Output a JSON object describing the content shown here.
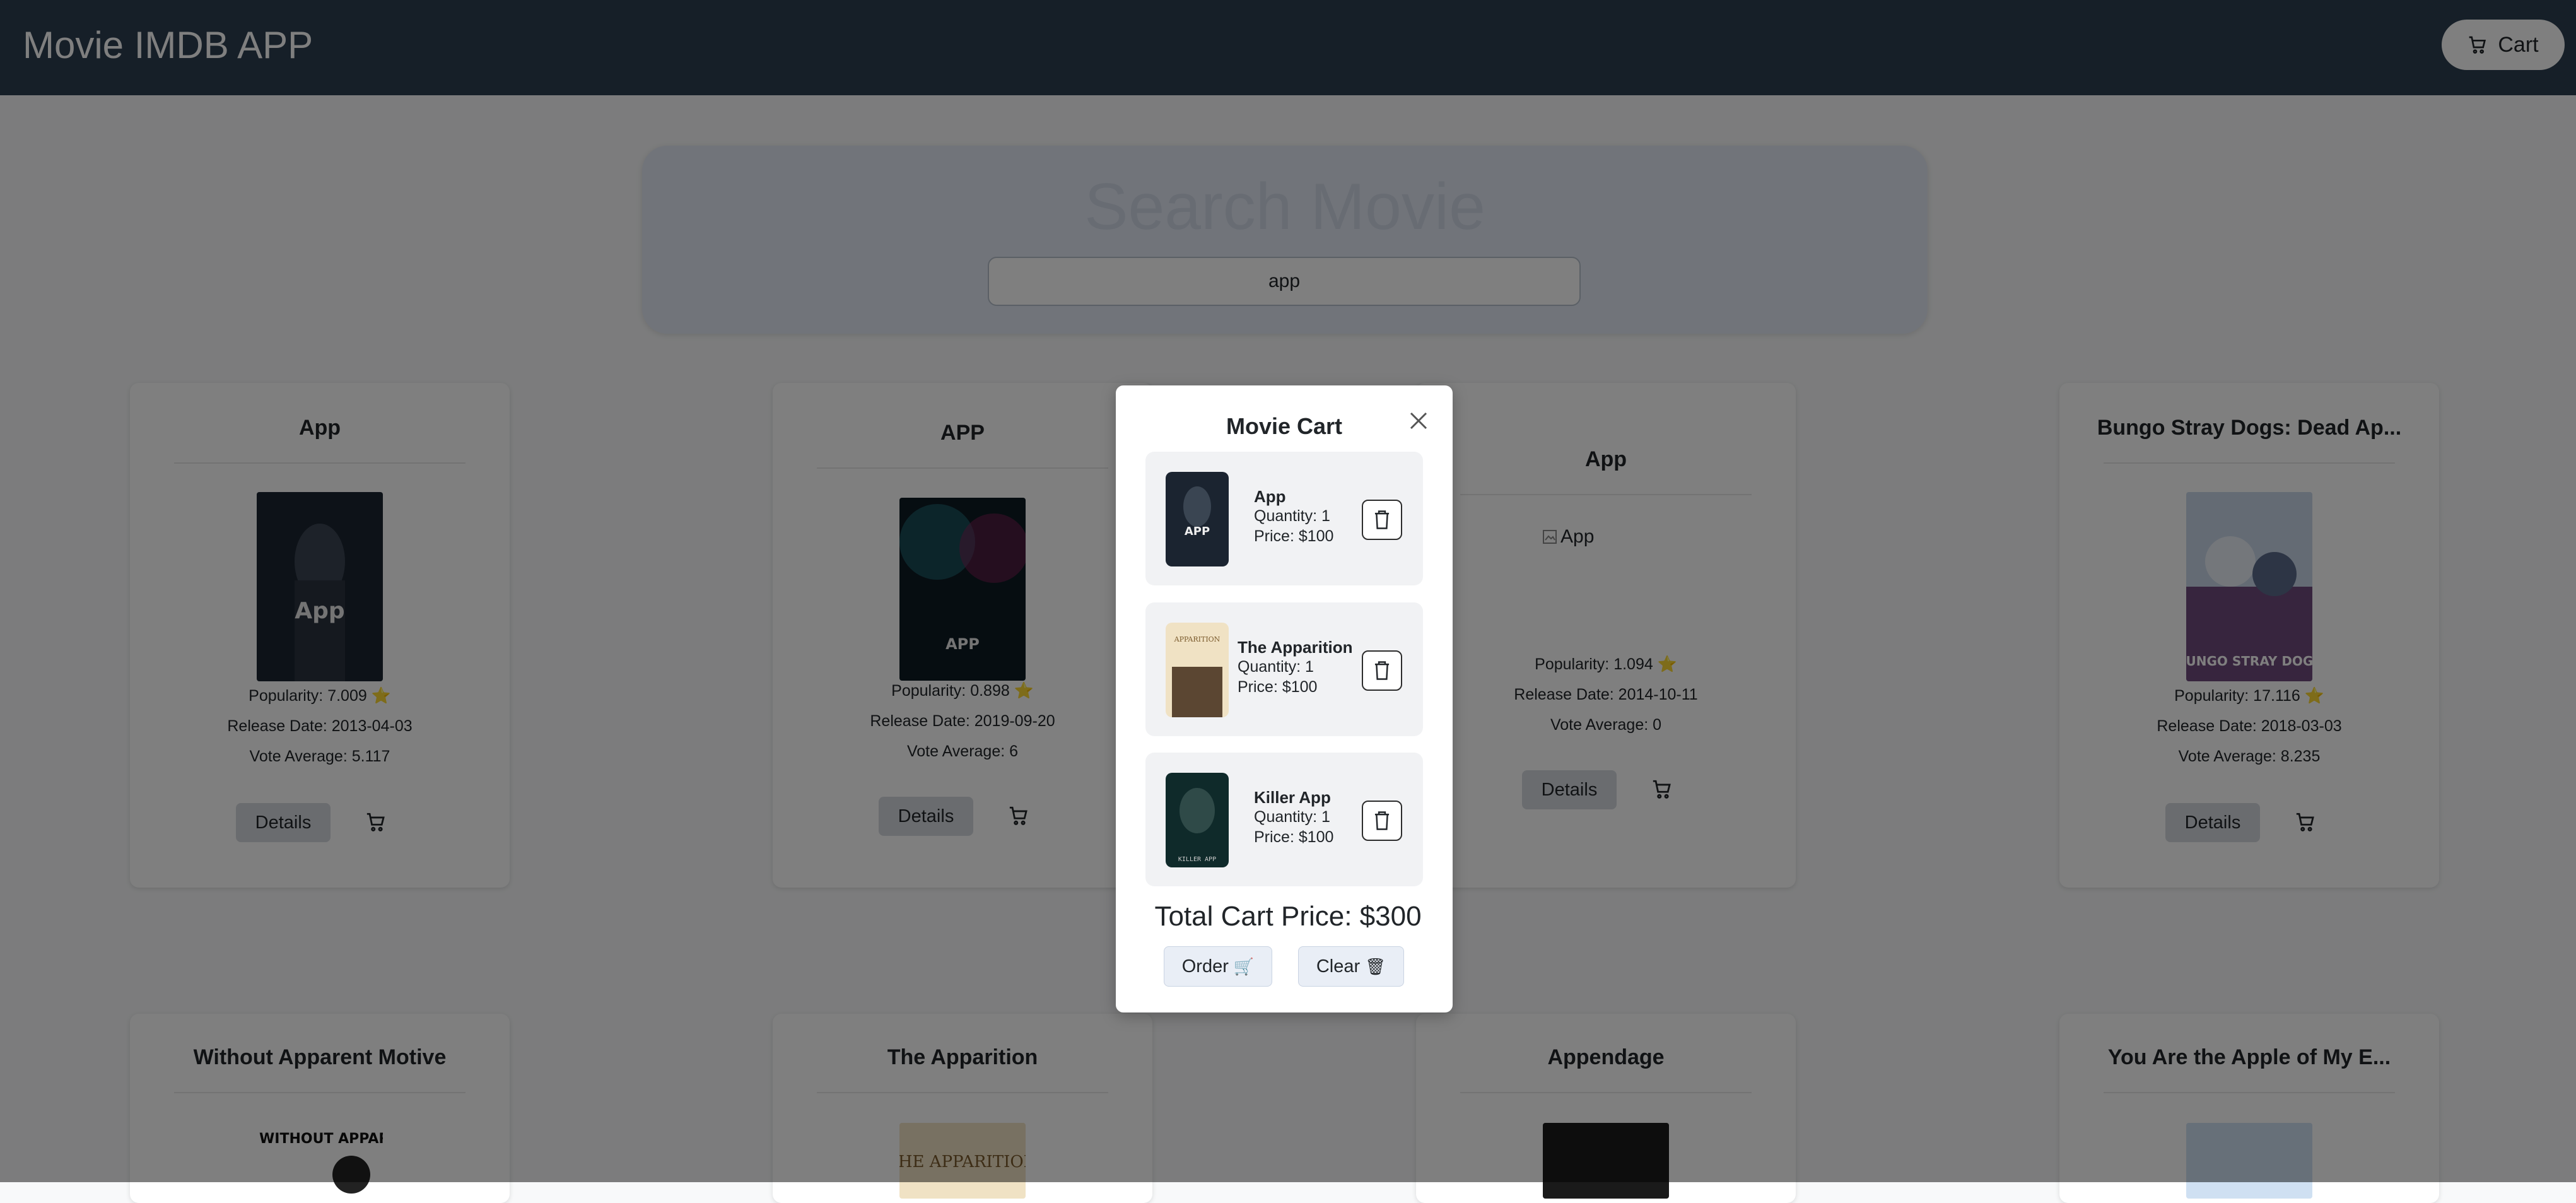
{
  "app": {
    "title": "Movie IMDB APP",
    "cart_label": "Cart"
  },
  "search": {
    "heading": "Search Movie",
    "value": "app"
  },
  "labels": {
    "popularity_prefix": "Popularity:",
    "release_prefix": "Release Date:",
    "vote_prefix": "Vote Average:",
    "details": "Details"
  },
  "movies": [
    {
      "title": "App",
      "popularity": "Popularity: 7.009 ⭐",
      "release": "Release Date: 2013-04-03",
      "vote": "Vote Average: 5.117",
      "poster": "App"
    },
    {
      "title": "APP",
      "popularity": "Popularity: 0.898 ⭐",
      "release": "Release Date: 2019-09-20",
      "vote": "Vote Average: 6",
      "poster": "APP"
    },
    {
      "title": "App",
      "popularity": "Popularity: 1.094 ⭐",
      "release": "Release Date: 2014-10-11",
      "vote": "Vote Average: 0",
      "poster_alt": "App"
    },
    {
      "title": "Bungo Stray Dogs: Dead Ap...",
      "popularity": "Popularity: 17.116 ⭐",
      "release": "Release Date: 2018-03-03",
      "vote": "Vote Average: 8.235",
      "poster": "BUNGO STRAY DOGS"
    },
    {
      "title": "Without Apparent Motive",
      "poster": "WITHOUT APPARENT MOTIVE"
    },
    {
      "title": "The Apparition",
      "poster": "THE APPARITION"
    },
    {
      "title": "Appendage"
    },
    {
      "title": "You Are the Apple of My E..."
    }
  ],
  "cart_modal": {
    "title": "Movie Cart",
    "items": [
      {
        "name": "App",
        "quantity": "Quantity: 1",
        "price": "Price: $100",
        "thumb_text": "APP"
      },
      {
        "name": "The Apparition",
        "quantity": "Quantity: 1",
        "price": "Price: $100",
        "thumb_text": "APPARITION"
      },
      {
        "name": "Killer App",
        "quantity": "Quantity: 1",
        "price": "Price: $100",
        "thumb_text": "KILLER APP"
      }
    ],
    "total": "Total Cart Price: $300",
    "order_label": "Order",
    "clear_label": "Clear",
    "order_emoji": "🛒",
    "clear_emoji": "🗑"
  },
  "colors": {
    "navbar": "#2c3e50",
    "accent_button": "#d5d9de",
    "overlay": "rgba(0,0,0,0.5)"
  },
  "icons": [
    "cart-icon",
    "close-icon",
    "trash-icon",
    "broken-image-icon"
  ]
}
